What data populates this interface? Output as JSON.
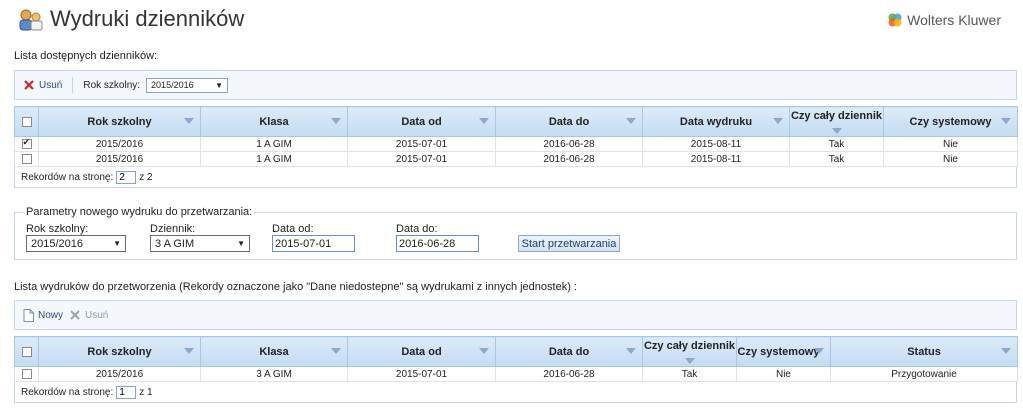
{
  "header": {
    "title": "Wydruki dzienników",
    "brand": "Wolters Kluwer"
  },
  "list1": {
    "label": "Lista dostępnych dzienników:",
    "toolbar": {
      "delete": "Usuń",
      "year_label": "Rok szkolny:",
      "year_value": "2015/2016"
    },
    "columns": [
      "Rok szkolny",
      "Klasa",
      "Data od",
      "Data do",
      "Data wydruku",
      "Czy cały dziennik",
      "Czy systemowy"
    ],
    "rows": [
      {
        "checked": true,
        "cells": [
          "2015/2016",
          "1 A GIM",
          "2015-07-01",
          "2016-06-28",
          "2015-08-11",
          "Tak",
          "Nie"
        ]
      },
      {
        "checked": false,
        "cells": [
          "2015/2016",
          "1 A GIM",
          "2015-07-01",
          "2016-06-28",
          "2015-08-11",
          "Tak",
          "Nie"
        ]
      }
    ],
    "footer": {
      "label": "Rekordów na stronę:",
      "value": "2",
      "of": "z 2"
    }
  },
  "params": {
    "legend": "Parametry nowego wydruku do przetwarzania:",
    "year_label": "Rok szkolny:",
    "year_value": "2015/2016",
    "journal_label": "Dziennik:",
    "journal_value": "3 A GIM",
    "from_label": "Data od:",
    "from_value": "2015-07-01",
    "to_label": "Data do:",
    "to_value": "2016-06-28",
    "start": "Start przetwarzania"
  },
  "list2": {
    "label": "Lista wydruków do przetworzenia (Rekordy oznaczone jako \"Dane niedostepne\" są wydrukami z innych jednostek) :",
    "toolbar": {
      "new": "Nowy",
      "delete": "Usuń"
    },
    "columns": [
      "Rok szkolny",
      "Klasa",
      "Data od",
      "Data do",
      "Czy cały dziennik",
      "Czy systemowy",
      "Status"
    ],
    "rows": [
      {
        "checked": false,
        "cells": [
          "2015/2016",
          "3 A GIM",
          "2015-07-01",
          "2016-06-28",
          "Tak",
          "Nie",
          "Przygotowanie"
        ]
      }
    ],
    "footer": {
      "label": "Rekordów na stronę:",
      "value": "1",
      "of": "z 1"
    }
  },
  "colors": {
    "header_bg": "#c4dbf2",
    "border": "#c7d7ea",
    "accent": "#2d4d7a"
  }
}
